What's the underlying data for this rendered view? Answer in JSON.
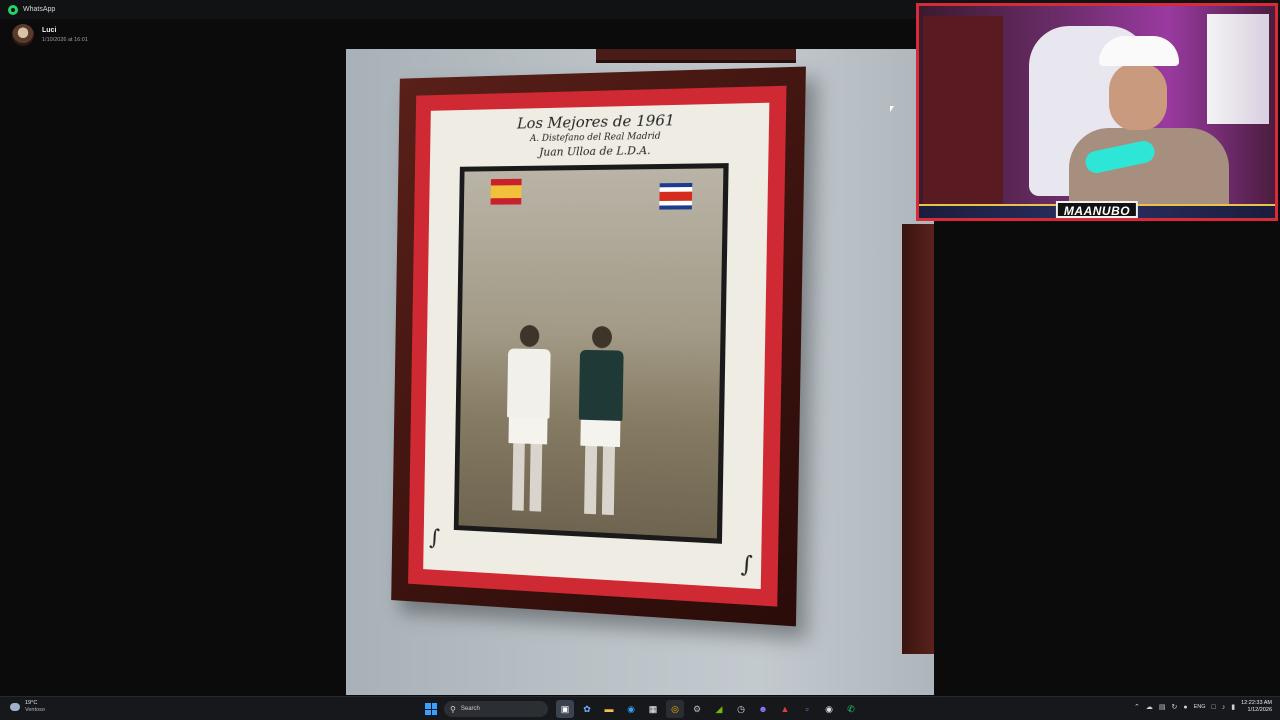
{
  "window": {
    "title": "WhatsApp"
  },
  "media_viewer": {
    "sender": "Luci",
    "timestamp": "1/10/2026 at 16:01"
  },
  "photo": {
    "caption_line1": "Los Mejores de 1961",
    "caption_line2": "A. Distefano del Real Madrid",
    "caption_line3": "Juan Ulloa de L.D.A."
  },
  "webcam": {
    "streamer_name": "MAANUBO"
  },
  "taskbar": {
    "weather_temp": "19°C",
    "weather_desc": "Ventoso",
    "search_label": "Search",
    "language": "ENG",
    "time": "12:22:33 AM",
    "date": "1/12/2026"
  },
  "colors": {
    "accent_whatsapp": "#25d366",
    "mat_red": "#cf2a34",
    "webcam_border": "#d72b3a",
    "taskbar_bg": "#16181c"
  }
}
